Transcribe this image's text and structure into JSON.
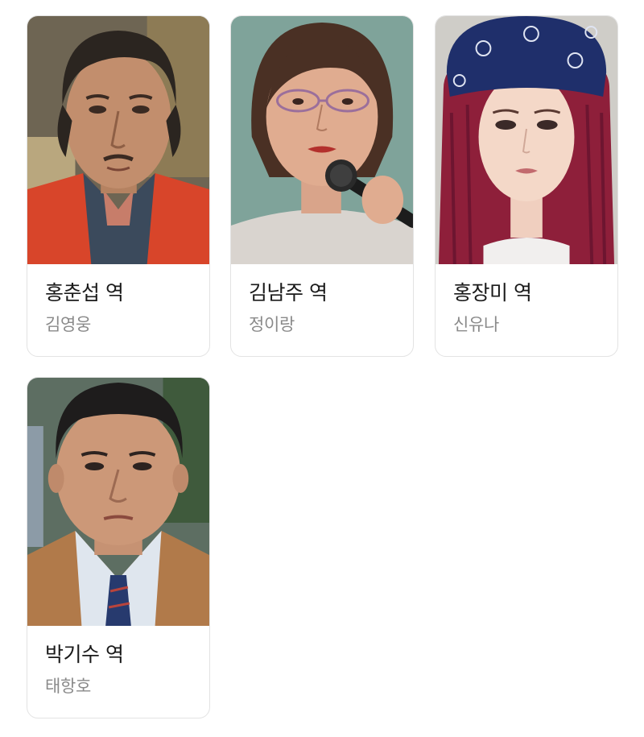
{
  "cast": [
    {
      "role": "홍춘섭 역",
      "actor": "김영웅",
      "photo_icon": "portrait-photo"
    },
    {
      "role": "김남주 역",
      "actor": "정이랑",
      "photo_icon": "portrait-photo"
    },
    {
      "role": "홍장미 역",
      "actor": "신유나",
      "photo_icon": "portrait-photo"
    },
    {
      "role": "박기수 역",
      "actor": "태항호",
      "photo_icon": "portrait-photo"
    }
  ],
  "colors": {
    "card_border": "#e3e3e3",
    "role_text": "#1a1a1a",
    "actor_text": "#8a8a8a"
  }
}
